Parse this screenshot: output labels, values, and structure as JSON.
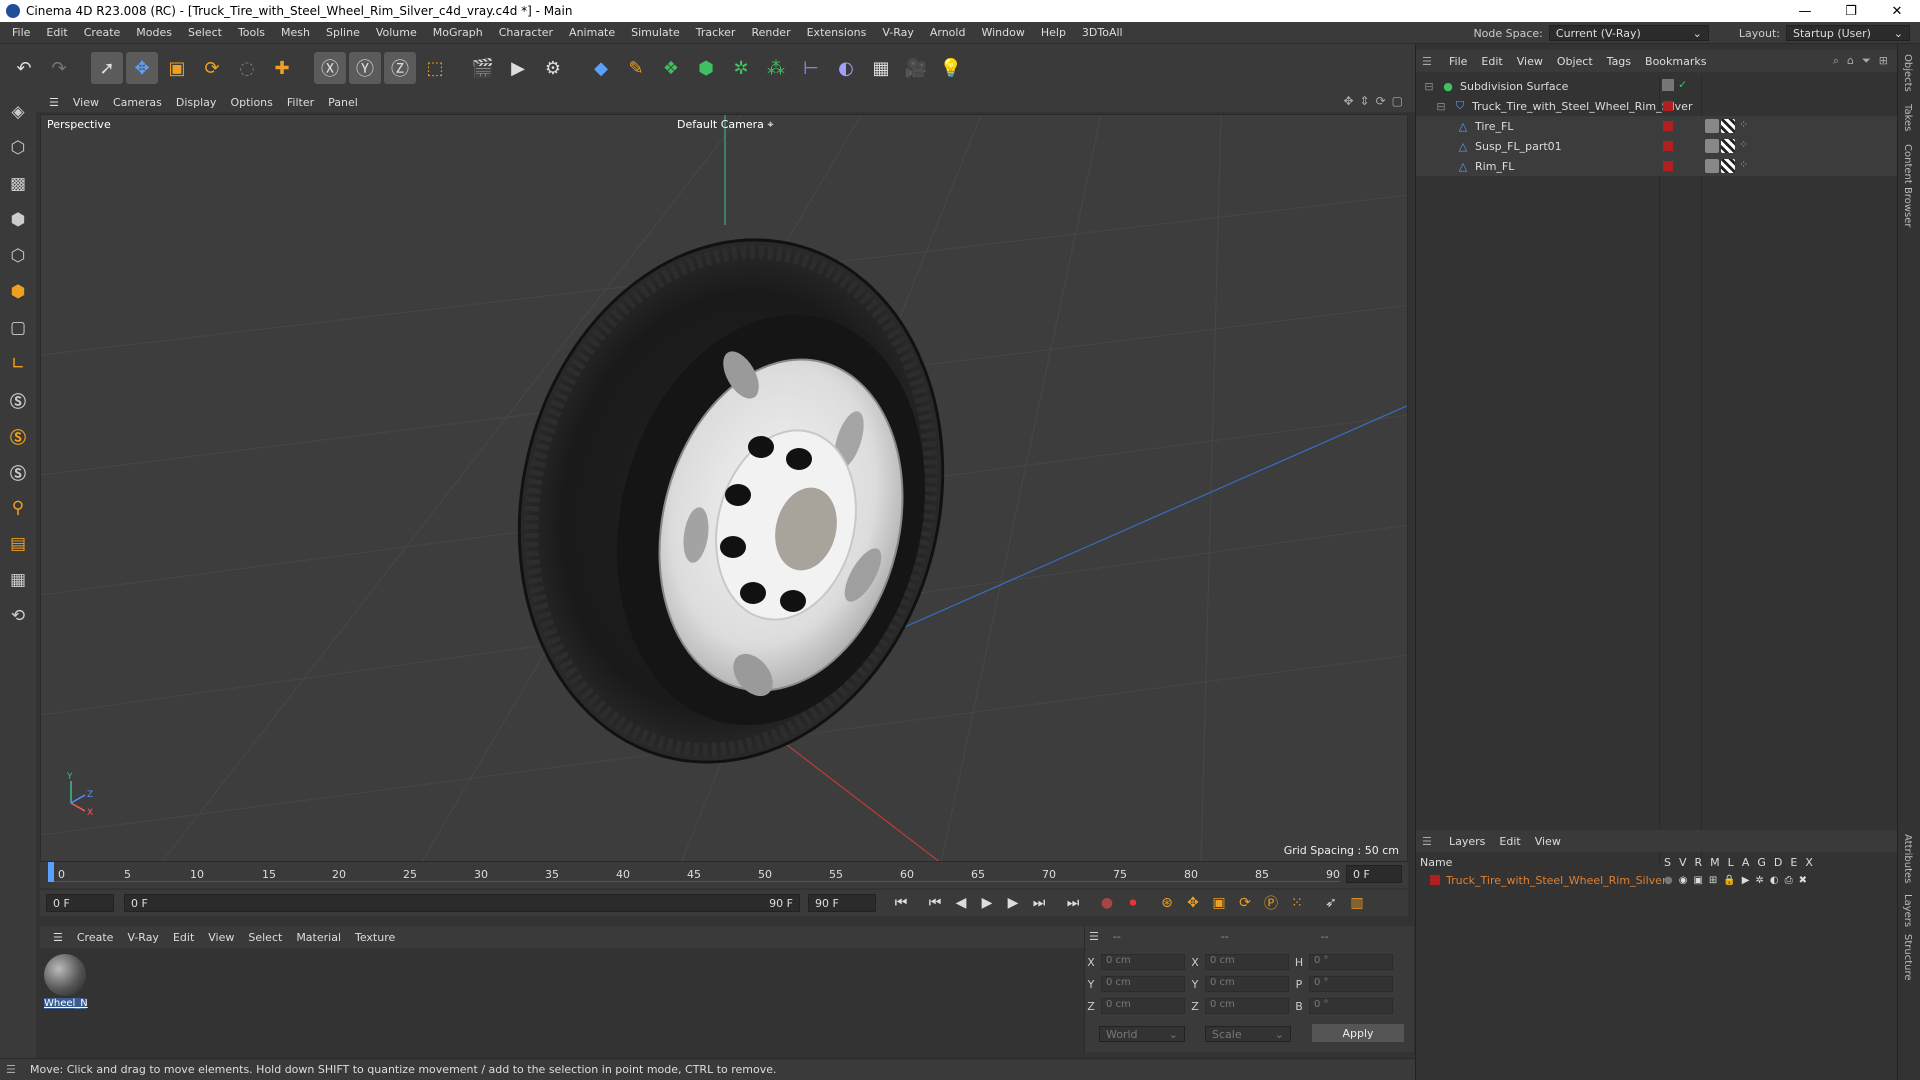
{
  "window": {
    "title": "Cinema 4D R23.008 (RC) - [Truck_Tire_with_Steel_Wheel_Rim_Silver_c4d_vray.c4d *] - Main",
    "controls": [
      "—",
      "❐",
      "✕"
    ]
  },
  "menubar": {
    "items": [
      "File",
      "Edit",
      "Create",
      "Modes",
      "Select",
      "Tools",
      "Mesh",
      "Spline",
      "Volume",
      "MoGraph",
      "Character",
      "Animate",
      "Simulate",
      "Tracker",
      "Render",
      "Extensions",
      "V-Ray",
      "Arnold",
      "Window",
      "Help",
      "3DToAll"
    ],
    "node_space_label": "Node Space:",
    "node_space_value": "Current (V-Ray)",
    "layout_label": "Layout:",
    "layout_value": "Startup (User)"
  },
  "toolbar": {
    "icons": [
      "undo-icon",
      "redo-icon",
      "select-icon",
      "move-icon",
      "scale-icon",
      "rotate-icon",
      "live-select-icon",
      "coord-icon",
      "x-axis-icon",
      "y-axis-icon",
      "z-axis-icon",
      "world-coord-icon",
      "render-region-icon",
      "render-view-icon",
      "render-settings-icon",
      "cube-icon",
      "pen-icon",
      "subdivision-icon",
      "extrude-icon",
      "cloner-icon",
      "array-icon",
      "symmetry-icon",
      "deformer-icon",
      "floor-icon",
      "camera-icon",
      "light-icon"
    ]
  },
  "viewport": {
    "menu": [
      "View",
      "Cameras",
      "Display",
      "Options",
      "Filter",
      "Panel"
    ],
    "name": "Perspective",
    "camera": "Default Camera",
    "grid_spacing": "Grid Spacing : 50 cm"
  },
  "timeline": {
    "ticks": [
      "0",
      "5",
      "10",
      "15",
      "20",
      "25",
      "30",
      "35",
      "40",
      "45",
      "50",
      "55",
      "60",
      "65",
      "70",
      "75",
      "80",
      "85",
      "90"
    ],
    "current_frame": "0 F",
    "start_frame": "0 F",
    "range_start": "0 F",
    "range_end": "90 F",
    "end_frame": "90 F"
  },
  "materials": {
    "menu": [
      "Create",
      "V-Ray",
      "Edit",
      "View",
      "Select",
      "Material",
      "Texture"
    ],
    "items": [
      {
        "label": "Wheel_N"
      }
    ]
  },
  "coordinates": {
    "headers": [
      "--",
      "--",
      "--"
    ],
    "rows": [
      {
        "a": "X",
        "av": "0 cm",
        "b": "X",
        "bv": "0 cm",
        "c": "H",
        "cv": "0 °"
      },
      {
        "a": "Y",
        "av": "0 cm",
        "b": "Y",
        "bv": "0 cm",
        "c": "P",
        "cv": "0 °"
      },
      {
        "a": "Z",
        "av": "0 cm",
        "b": "Z",
        "bv": "0 cm",
        "c": "B",
        "cv": "0 °"
      }
    ],
    "space": "World",
    "mode": "Scale",
    "apply": "Apply"
  },
  "status": "Move: Click and drag to move elements. Hold down SHIFT to quantize movement / add to the selection in point mode, CTRL to remove.",
  "objects": {
    "menu": [
      "File",
      "Edit",
      "View",
      "Object",
      "Tags",
      "Bookmarks"
    ],
    "items": [
      {
        "name": "Subdivision Surface",
        "indent": 0
      },
      {
        "name": "Truck_Tire_with_Steel_Wheel_Rim_Silver",
        "indent": 1
      },
      {
        "name": "Tire_FL",
        "indent": 2
      },
      {
        "name": "Susp_FL_part01",
        "indent": 2
      },
      {
        "name": "Rim_FL",
        "indent": 2
      }
    ]
  },
  "layers": {
    "menu": [
      "Layers",
      "Edit",
      "View"
    ],
    "name_header": "Name",
    "columns": [
      "S",
      "V",
      "R",
      "M",
      "L",
      "A",
      "G",
      "D",
      "E",
      "X"
    ],
    "items": [
      {
        "name": "Truck_Tire_with_Steel_Wheel_Rim_Silver"
      }
    ]
  },
  "side_tabs": [
    "Objects",
    "Takes",
    "Content Browser",
    "Attributes",
    "Layers",
    "Structure"
  ],
  "colors": {
    "accent_blue": "#3b5c8f",
    "layer_orange": "#e08030",
    "layer_red": "#b02020"
  }
}
